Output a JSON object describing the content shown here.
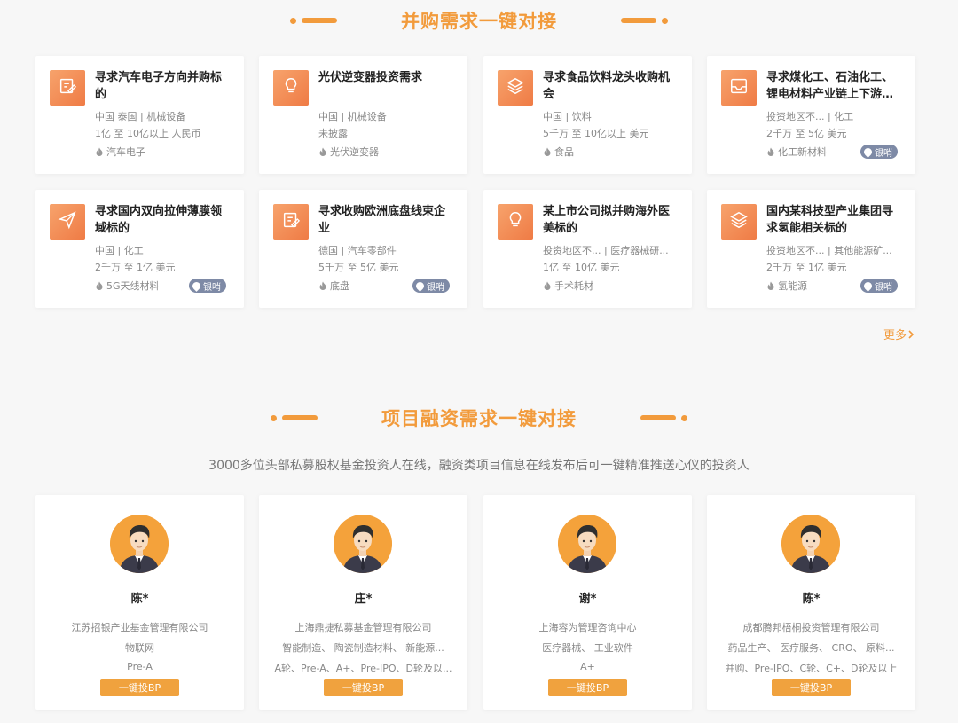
{
  "ma": {
    "title": "并购需求一键对接",
    "more": "更多",
    "deals": [
      {
        "title": "寻求汽车电子方向并购标的",
        "m1": "中国  泰国  | 机械设备",
        "m2": "1亿  至  10亿以上  人民币",
        "tag": "汽车电子",
        "badge": "",
        "icon": "edit-note-icon"
      },
      {
        "title": "光伏逆变器投资需求",
        "m1": "中国  | 机械设备",
        "m2": "未披露",
        "tag": "光伏逆变器",
        "badge": "",
        "icon": "lightbulb-icon"
      },
      {
        "title": "寻求食品饮料龙头收购机会",
        "m1": "中国  | 饮料",
        "m2": "5千万  至  10亿以上  美元",
        "tag": "食品",
        "badge": "",
        "icon": "layers-icon"
      },
      {
        "title": "寻求煤化工、石油化工、锂电材料产业链上下游企业",
        "m1": "投资地区不...  | 化工",
        "m2": "2千万  至  5亿  美元",
        "tag": "化工新材料",
        "badge": "银哨",
        "icon": "inbox-icon"
      },
      {
        "title": "寻求国内双向拉伸薄膜领域标的",
        "m1": "中国  | 化工",
        "m2": "2千万  至  1亿  美元",
        "tag": "5G天线材料",
        "badge": "银哨",
        "icon": "paper-plane-icon"
      },
      {
        "title": "寻求收购欧洲底盘线束企业",
        "m1": "德国  | 汽车零部件",
        "m2": "5千万  至  5亿  美元",
        "tag": "底盘",
        "badge": "银哨",
        "icon": "edit-note-icon"
      },
      {
        "title": "某上市公司拟并购海外医美标的",
        "m1": "投资地区不...  | 医疗器械研...",
        "m2": "1亿  至  10亿  美元",
        "tag": "手术耗材",
        "badge": "",
        "icon": "lightbulb-icon"
      },
      {
        "title": "国内某科技型产业集团寻求氢能相关标的",
        "m1": "投资地区不...  | 其他能源矿...",
        "m2": "2千万  至  1亿  美元",
        "tag": "氢能源",
        "badge": "银哨",
        "icon": "layers-icon"
      }
    ]
  },
  "financing": {
    "title": "项目融资需求一键对接",
    "subtitle": "3000多位头部私募股权基金投资人在线，融资类项目信息在线发布后可一键精准推送心仪的投资人",
    "button_label": "一键投BP",
    "investors": [
      {
        "name": "陈*",
        "company": "江苏招银产业基金管理有限公司",
        "sectors": "物联网",
        "stages": "Pre-A"
      },
      {
        "name": "庄*",
        "company": "上海鼎捷私募基金管理有限公司",
        "sectors": "智能制造、 陶瓷制造材料、 新能源...",
        "stages": "A轮、Pre-A、A+、Pre-IPO、D轮及以..."
      },
      {
        "name": "谢*",
        "company": "上海容为管理咨询中心",
        "sectors": "医疗器械、 工业软件",
        "stages": "A+"
      },
      {
        "name": "陈*",
        "company": "成都腾邦梧桐投资管理有限公司",
        "sectors": "药品生产、 医疗服务、 CRO、 原料...",
        "stages": "并购、Pre-IPO、C轮、C+、D轮及以上"
      }
    ]
  },
  "colors": {
    "accent": "#f29b3c",
    "icon_gradient_start": "#f7a36c",
    "icon_gradient_end": "#ef7b45",
    "badge": "#7e8aa6"
  }
}
